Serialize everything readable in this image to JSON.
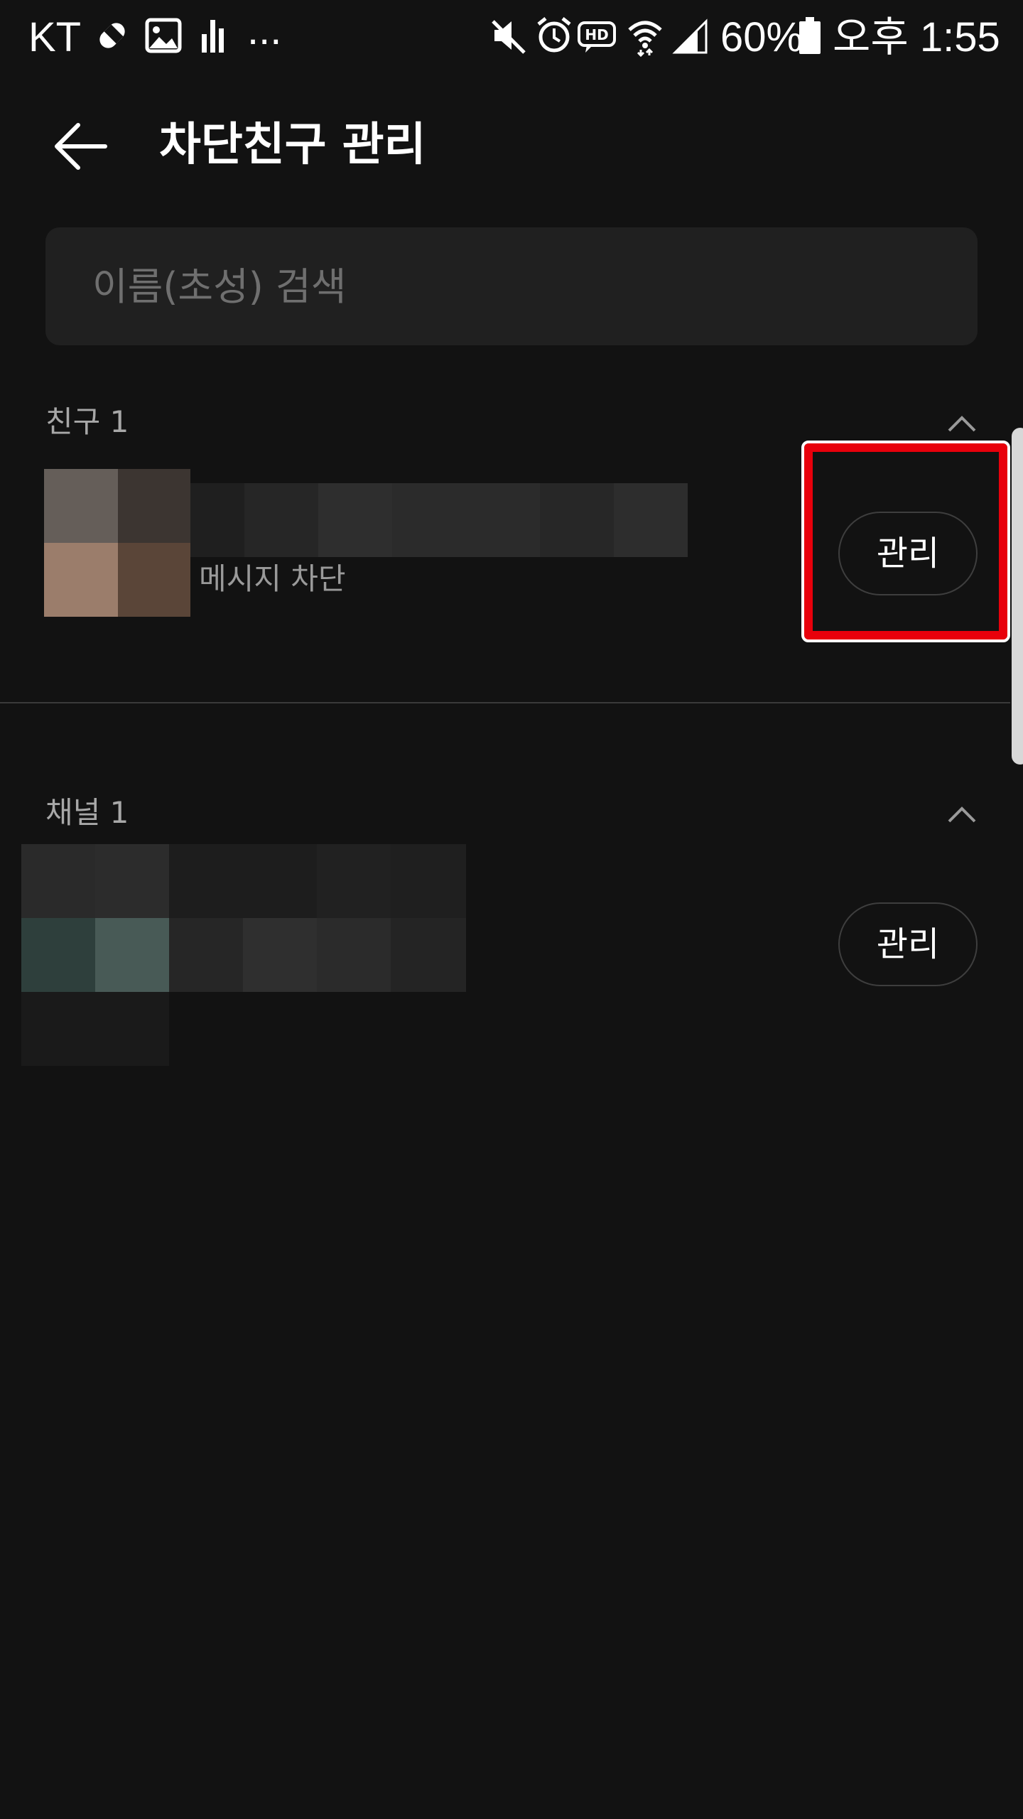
{
  "status_bar": {
    "carrier": "KT",
    "more": "...",
    "battery": "60%",
    "time": "오후 1:55",
    "icons": [
      "bandage-icon",
      "image-icon",
      "bar-chart-icon",
      "mute-icon",
      "alarm-icon",
      "hd-voice-icon",
      "wifi-icon",
      "signal-icon",
      "battery-icon"
    ]
  },
  "app_bar": {
    "back_icon": "back-arrow-icon",
    "title": "차단친구 관리"
  },
  "search": {
    "placeholder": "이름(초성) 검색"
  },
  "friends_section": {
    "label": "친구 1",
    "collapse_icon": "chevron-up-icon",
    "items": [
      {
        "status": "메시지 차단",
        "button_label": "관리",
        "avatar": "pixelated-avatar"
      }
    ]
  },
  "channels_section": {
    "label": "채널 1",
    "collapse_icon": "chevron-up-icon",
    "items": [
      {
        "button_label": "관리",
        "avatar": "pixelated-avatar"
      }
    ]
  },
  "colors": {
    "background": "#121212",
    "search_background": "#202020",
    "highlight": "#e8000b"
  }
}
